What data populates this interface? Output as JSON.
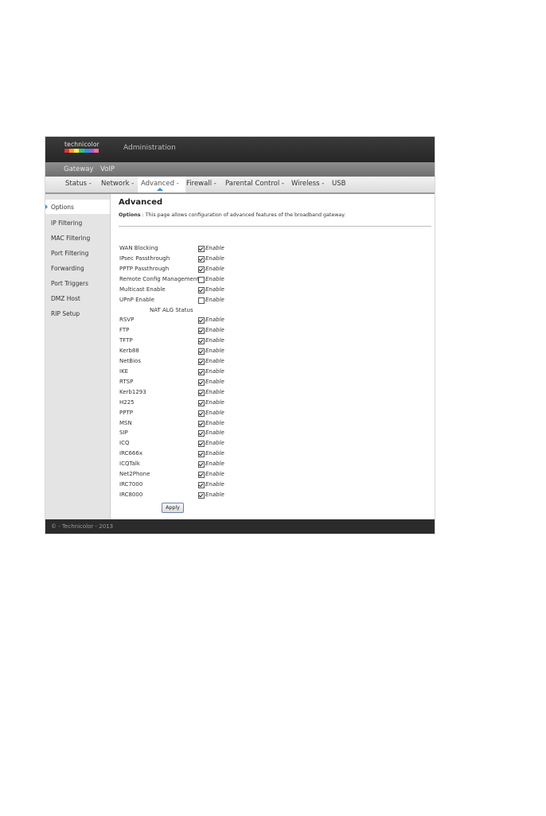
{
  "header": {
    "logo_text": "technicolor",
    "logo_colors": [
      "#e3342f",
      "#f6993f",
      "#ffed4a",
      "#38c172",
      "#3490dc",
      "#9561e2",
      "#f66d9b"
    ],
    "title": "Administration"
  },
  "subnav": {
    "gateway": "Gateway",
    "voip": "VoIP"
  },
  "mainnav": {
    "items": [
      "Status -",
      "Network -",
      "Advanced -",
      "Firewall -",
      "Parental Control -",
      "Wireless -",
      "USB"
    ],
    "active": "Advanced -"
  },
  "sidebar": {
    "items": [
      "Options",
      "IP Filtering",
      "MAC Filtering",
      "Port Filtering",
      "Forwarding",
      "Port Triggers",
      "DMZ Host",
      "RIP Setup"
    ],
    "active": "Options"
  },
  "content": {
    "title": "Advanced",
    "desc_label": "Options",
    "desc_sep": ":",
    "desc_text": "This page allows configuration of advanced features of the broadband gateway.",
    "enable_text": "Enable",
    "nat_header": "NAT ALG Status",
    "options": [
      {
        "label": "WAN Blocking",
        "checked": true
      },
      {
        "label": "IPsec Passthrough",
        "checked": true
      },
      {
        "label": "PPTP Passthrough",
        "checked": true
      },
      {
        "label": "Remote Config Management",
        "checked": false
      },
      {
        "label": "Multicast Enable",
        "checked": true
      },
      {
        "label": "UPnP Enable",
        "checked": false
      }
    ],
    "nat": [
      {
        "label": "RSVP",
        "checked": true
      },
      {
        "label": "FTP",
        "checked": true
      },
      {
        "label": "TFTP",
        "checked": true
      },
      {
        "label": "Kerb88",
        "checked": true
      },
      {
        "label": "NetBios",
        "checked": true
      },
      {
        "label": "IKE",
        "checked": true
      },
      {
        "label": "RTSP",
        "checked": true
      },
      {
        "label": "Kerb1293",
        "checked": true
      },
      {
        "label": "H225",
        "checked": true
      },
      {
        "label": "PPTP",
        "checked": true
      },
      {
        "label": "MSN",
        "checked": true
      },
      {
        "label": "SIP",
        "checked": true
      },
      {
        "label": "ICQ",
        "checked": true
      },
      {
        "label": "IRC666x",
        "checked": true
      },
      {
        "label": "ICQTalk",
        "checked": true
      },
      {
        "label": "Net2Phone",
        "checked": true
      },
      {
        "label": "IRC7000",
        "checked": true
      },
      {
        "label": "IRC8000",
        "checked": true
      }
    ],
    "apply_label": "Apply"
  },
  "footer": {
    "text": "© - Technicolor - 2013"
  }
}
